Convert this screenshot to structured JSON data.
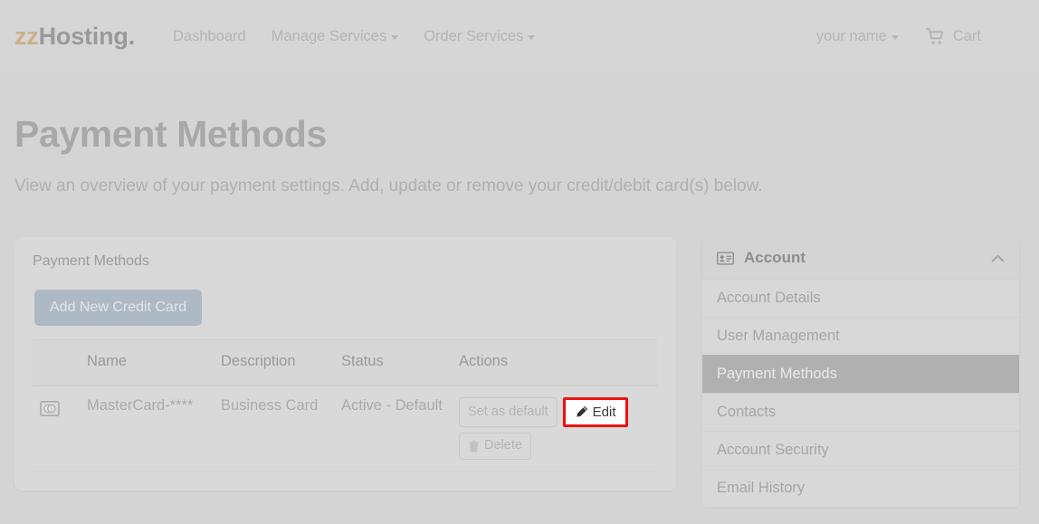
{
  "header": {
    "brand_prefix": "zz",
    "brand_rest": "Hosting.",
    "nav": [
      {
        "label": "Dashboard",
        "has_caret": false,
        "icon": ""
      },
      {
        "label": "Manage Services",
        "has_caret": true,
        "icon": ""
      },
      {
        "label": "Order Services",
        "has_caret": true,
        "icon": ""
      }
    ],
    "user_menu": {
      "label": "your name",
      "has_caret": true
    },
    "cart": {
      "label": "Cart",
      "icon": "shopping-cart-icon"
    }
  },
  "page": {
    "title": "Payment Methods",
    "subtitle": "View an overview of your payment settings. Add, update or remove your credit/debit card(s) below."
  },
  "panel": {
    "title": "Payment Methods",
    "add_button_label": "Add New Credit Card",
    "table": {
      "columns": [
        "",
        "Name",
        "Description",
        "Status",
        "Actions"
      ],
      "rows": [
        {
          "icon": "credit-card-icon",
          "name": "MasterCard-****",
          "description": "Business Card",
          "status": "Active - Default",
          "actions": {
            "set_default_label": "Set as default",
            "edit_label": "Edit",
            "delete_label": "Delete"
          }
        }
      ]
    }
  },
  "sidebar": {
    "header": {
      "label": "Account",
      "icon": "id-card-icon",
      "chevron": "chevron-up-icon"
    },
    "items": [
      {
        "label": "Account Details",
        "active": false
      },
      {
        "label": "User Management",
        "active": false
      },
      {
        "label": "Payment Methods",
        "active": true
      },
      {
        "label": "Contacts",
        "active": false
      },
      {
        "label": "Account Security",
        "active": false
      },
      {
        "label": "Email History",
        "active": false
      }
    ]
  },
  "colors": {
    "page_background": "#d4d4d4",
    "panel_background": "#d9d9d9",
    "brand_accent": "#cbb08a",
    "add_button": "#adb9c4",
    "active_item": "#b0b0b0",
    "highlight_border": "#ee1111"
  }
}
